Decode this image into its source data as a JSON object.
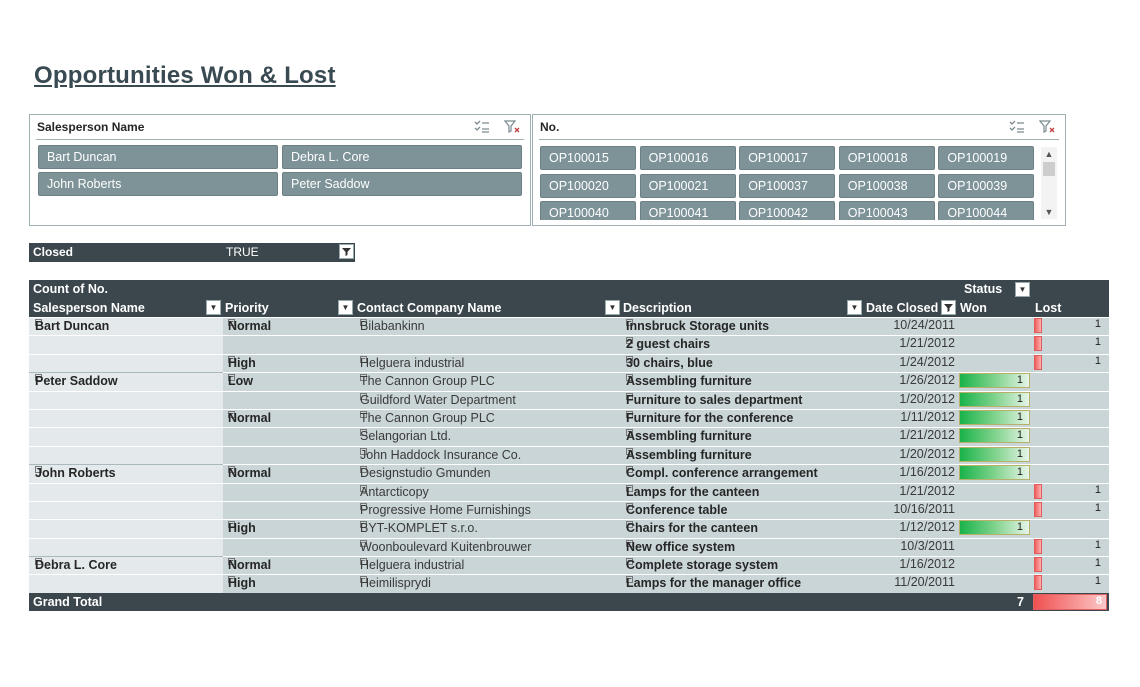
{
  "title": "Opportunities Won & Lost",
  "slicer_sales": {
    "header": "Salesperson Name",
    "items": [
      "Bart Duncan",
      "Debra L. Core",
      "John Roberts",
      "Peter Saddow"
    ]
  },
  "slicer_no": {
    "header": "No.",
    "items": [
      "OP100015",
      "OP100016",
      "OP100017",
      "OP100018",
      "OP100019",
      "OP100020",
      "OP100021",
      "OP100037",
      "OP100038",
      "OP100039",
      "OP100040",
      "OP100041",
      "OP100042",
      "OP100043",
      "OP100044"
    ],
    "scroll_up": "▲",
    "scroll_down": "▼"
  },
  "filter": {
    "label": "Closed",
    "value": "TRUE"
  },
  "pivot": {
    "header": {
      "count_label": "Count of No.",
      "status_label": "Status",
      "cols": [
        "Salesperson Name",
        "Priority",
        "Contact Company Name",
        "Description",
        "Date Closed",
        "Won",
        "Lost"
      ]
    },
    "rows": [
      {
        "sp": "Bart Duncan",
        "pr": "Normal",
        "co": "Bilabankinn",
        "de": "Innsbruck Storage units",
        "dt": "10/24/2011",
        "won": null,
        "lost": "1"
      },
      {
        "sp": "",
        "pr": "",
        "co": "",
        "de": "2 guest chairs",
        "dt": "1/21/2012",
        "won": null,
        "lost": "1"
      },
      {
        "sp": "",
        "pr": "High",
        "co": "Helguera industrial",
        "de": "30 chairs, blue",
        "dt": "1/24/2012",
        "won": null,
        "lost": "1"
      },
      {
        "sp": "Peter Saddow",
        "pr": "Low",
        "co": "The Cannon Group PLC",
        "de": "Assembling furniture",
        "dt": "1/26/2012",
        "won": "1",
        "lost": null
      },
      {
        "sp": "",
        "pr": "",
        "co": "Guildford Water Department",
        "de": "Furniture to sales department",
        "dt": "1/20/2012",
        "won": "1",
        "lost": null
      },
      {
        "sp": "",
        "pr": "Normal",
        "co": "The Cannon Group PLC",
        "de": "Furniture for the conference",
        "dt": "1/11/2012",
        "won": "1",
        "lost": null
      },
      {
        "sp": "",
        "pr": "",
        "co": "Selangorian Ltd.",
        "de": "Assembling furniture",
        "dt": "1/21/2012",
        "won": "1",
        "lost": null
      },
      {
        "sp": "",
        "pr": "",
        "co": "John Haddock Insurance Co.",
        "de": "Assembling furniture",
        "dt": "1/20/2012",
        "won": "1",
        "lost": null
      },
      {
        "sp": "John Roberts",
        "pr": "Normal",
        "co": "Designstudio Gmunden",
        "de": "Compl. conference arrangement",
        "dt": "1/16/2012",
        "won": "1",
        "lost": null
      },
      {
        "sp": "",
        "pr": "",
        "co": "Antarcticopy",
        "de": "Lamps for the canteen",
        "dt": "1/21/2012",
        "won": null,
        "lost": "1"
      },
      {
        "sp": "",
        "pr": "",
        "co": "Progressive Home Furnishings",
        "de": "Conference table",
        "dt": "10/16/2011",
        "won": null,
        "lost": "1"
      },
      {
        "sp": "",
        "pr": "High",
        "co": "BYT-KOMPLET s.r.o.",
        "de": "Chairs for the canteen",
        "dt": "1/12/2012",
        "won": "1",
        "lost": null
      },
      {
        "sp": "",
        "pr": "",
        "co": "Woonboulevard Kuitenbrouwer",
        "de": "New office system",
        "dt": "10/3/2011",
        "won": null,
        "lost": "1"
      },
      {
        "sp": "Debra L. Core",
        "pr": "Normal",
        "co": "Helguera industrial",
        "de": "Complete storage system",
        "dt": "1/16/2012",
        "won": null,
        "lost": "1"
      },
      {
        "sp": "",
        "pr": "High",
        "co": "Heimilisprydi",
        "de": "Lamps for the manager office",
        "dt": "11/20/2011",
        "won": null,
        "lost": "1"
      }
    ],
    "grand_total": {
      "label": "Grand Total",
      "won": "7",
      "lost": "8"
    }
  },
  "icons": {
    "multiselect": "multiselect-icon",
    "clear_filter": "clear-filter-icon",
    "expand_collapse": "collapse-icon",
    "dropdown": "dropdown-arrow-icon"
  }
}
